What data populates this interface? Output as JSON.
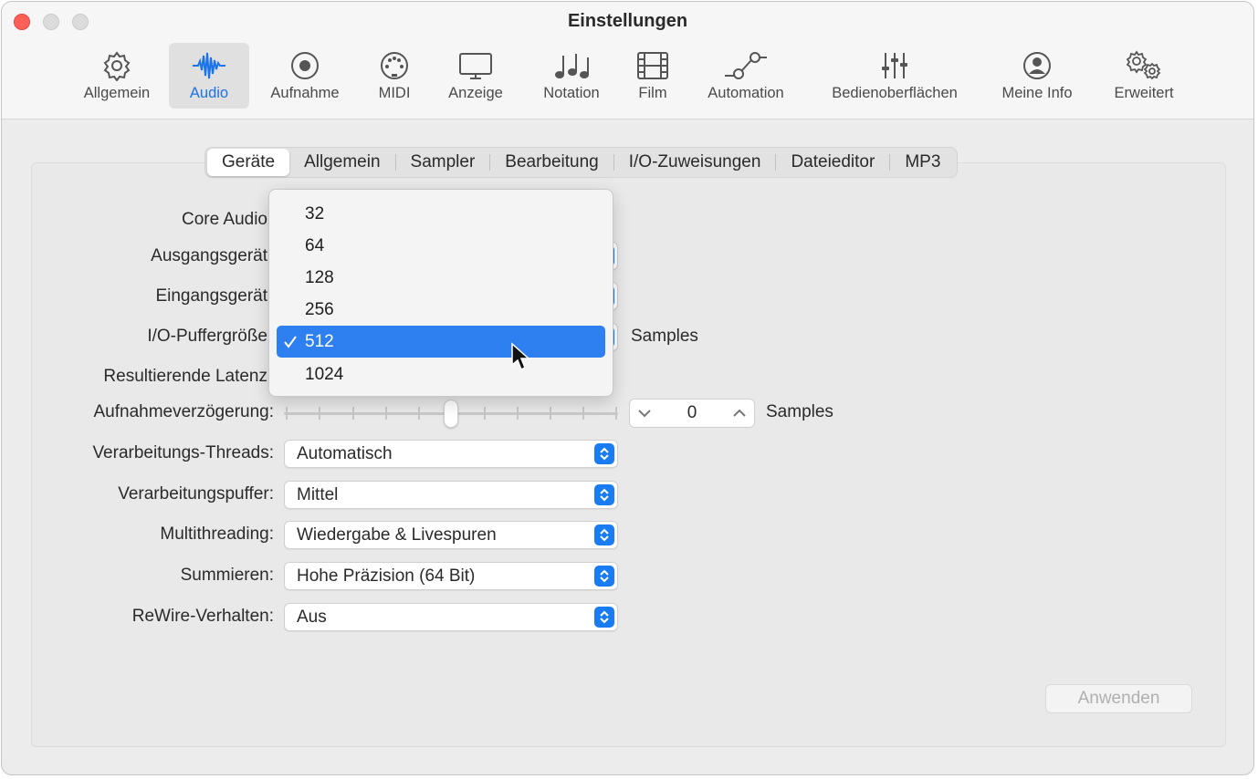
{
  "window": {
    "title": "Einstellungen"
  },
  "toolbar": [
    {
      "label": "Allgemein",
      "icon": "gear-icon",
      "active": false
    },
    {
      "label": "Audio",
      "icon": "waveform-icon",
      "active": true
    },
    {
      "label": "Aufnahme",
      "icon": "record-icon",
      "active": false
    },
    {
      "label": "MIDI",
      "icon": "midi-connector-icon",
      "active": false
    },
    {
      "label": "Anzeige",
      "icon": "display-icon",
      "active": false
    },
    {
      "label": "Notation",
      "icon": "music-notes-icon",
      "active": false
    },
    {
      "label": "Film",
      "icon": "film-strip-icon",
      "active": false
    },
    {
      "label": "Automation",
      "icon": "automation-curve-icon",
      "active": false
    },
    {
      "label": "Bedienoberflächen",
      "icon": "faders-icon",
      "active": false
    },
    {
      "label": "Meine Info",
      "icon": "person-icon",
      "active": false
    },
    {
      "label": "Erweitert",
      "icon": "gears-icon",
      "active": false
    }
  ],
  "tabs": [
    "Geräte",
    "Allgemein",
    "Sampler",
    "Bearbeitung",
    "I/O-Zuweisungen",
    "Dateieditor",
    "MP3"
  ],
  "selected_tab": "Geräte",
  "labels": {
    "core_audio": "Core Audio",
    "output": "Ausgangsgerät",
    "input": "Eingangsgerät",
    "buffer": "I/O-Puffergröße",
    "latency": "Resultierende Latenz",
    "rec_delay": "Aufnahmeverzögerung:",
    "threads": "Verarbeitungs-Threads:",
    "proc_buffer": "Verarbeitungspuffer:",
    "multithreading": "Multithreading:",
    "summing": "Summieren:",
    "rewire": "ReWire-Verhalten:"
  },
  "buffer_unit": "Samples",
  "rec_delay": {
    "value": "0",
    "unit": "Samples"
  },
  "popups": {
    "threads": "Automatisch",
    "proc_buffer": "Mittel",
    "multithreading": "Wiedergabe & Livespuren",
    "summing": "Hohe Präzision (64 Bit)",
    "rewire": "Aus"
  },
  "buffer_menu": {
    "options": [
      "32",
      "64",
      "128",
      "256",
      "512",
      "1024"
    ],
    "selected": "512"
  },
  "apply_button": "Anwenden",
  "colors": {
    "accent": "#1a7cf2",
    "highlight": "#2e7ff0",
    "close": "#fe5f57"
  }
}
